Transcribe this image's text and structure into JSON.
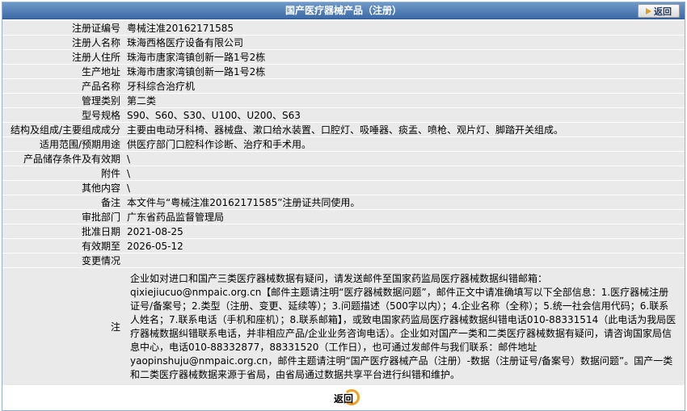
{
  "page": {
    "title": "国产医疗器械产品（注册）",
    "back_top_label": "返回",
    "back_bottom_label": "返回"
  },
  "fields": [
    {
      "label": "注册证编号",
      "value": "粤械注准20162171585"
    },
    {
      "label": "注册人名称",
      "value": "珠海西格医疗设备有限公司"
    },
    {
      "label": "注册人住所",
      "value": "珠海市唐家湾镇创新一路1号2栋"
    },
    {
      "label": "生产地址",
      "value": "珠海市唐家湾镇创新一路1号2栋"
    },
    {
      "label": "产品名称",
      "value": "牙科综合治疗机"
    },
    {
      "label": "管理类别",
      "value": "第二类"
    },
    {
      "label": "型号规格",
      "value": "S90、S60、S30、U100、U200、S63"
    },
    {
      "label": "结构及组成/主要组成成分",
      "value": "主要由电动牙科椅、器械盘、漱口给水装置、口腔灯、吸唾器、痰盂、喷枪、观片灯、脚踏开关组成。"
    },
    {
      "label": "适用范围/预期用途",
      "value": "供医疗部门口腔科作诊断、治疗和手术用。"
    },
    {
      "label": "产品储存条件及有效期",
      "value": "\\"
    },
    {
      "label": "附件",
      "value": "\\"
    },
    {
      "label": "其他内容",
      "value": "\\"
    },
    {
      "label": "备注",
      "value": "本文件与“粤械注准20162171585”注册证共同使用。"
    },
    {
      "label": "审批部门",
      "value": "广东省药品监督管理局"
    },
    {
      "label": "批准日期",
      "value": "2021-08-25"
    },
    {
      "label": "有效期至",
      "value": "2026-05-12"
    },
    {
      "label": "变更情况",
      "value": ""
    }
  ],
  "note": {
    "label": "注",
    "text": "企业如对进口和国产三类医疗器械数据有疑问，请发送邮件至国家药监局医疗器械数据纠错邮箱：qixiejiucuo@nmpaic.org.cn【邮件主题请注明“医疗器械数据问题”，邮件正文中请准确填写以下全部信息：1.医疗器械注册证号/备案号；2.类型（注册、变更、延续等）；3.问题描述（500字以内）；4.企业名称（全称）；5.统一社会信用代码；6.联系人姓名；7.联系电话（手机和座机）；8.联系邮箱】，或致电国家药监局医疗器械数据纠错电话010-88331514（此电话为我局医疗器械数据纠错联系电话，并非相应产品/企业业务咨询电话）。企业如对国产一类和二类医疗器械数据有疑问，请咨询国家局信息中心，电话010-88332877，88331520（工作日），也可通过发邮件与我们联系：邮件地址yaopinshuju@nmpaic.org.cn，邮件主题请注明“国产医疗器械产品（注册）-数据（注册证号/备案号）数据问题”。国产一类和二类医疗器械数据来源于省局，由省局通过数据共享平台进行纠错和维护。"
  },
  "colors": {
    "header_bg": "#4a78b2",
    "row_bg": "#eaeaea",
    "accent": "#f0a020"
  }
}
